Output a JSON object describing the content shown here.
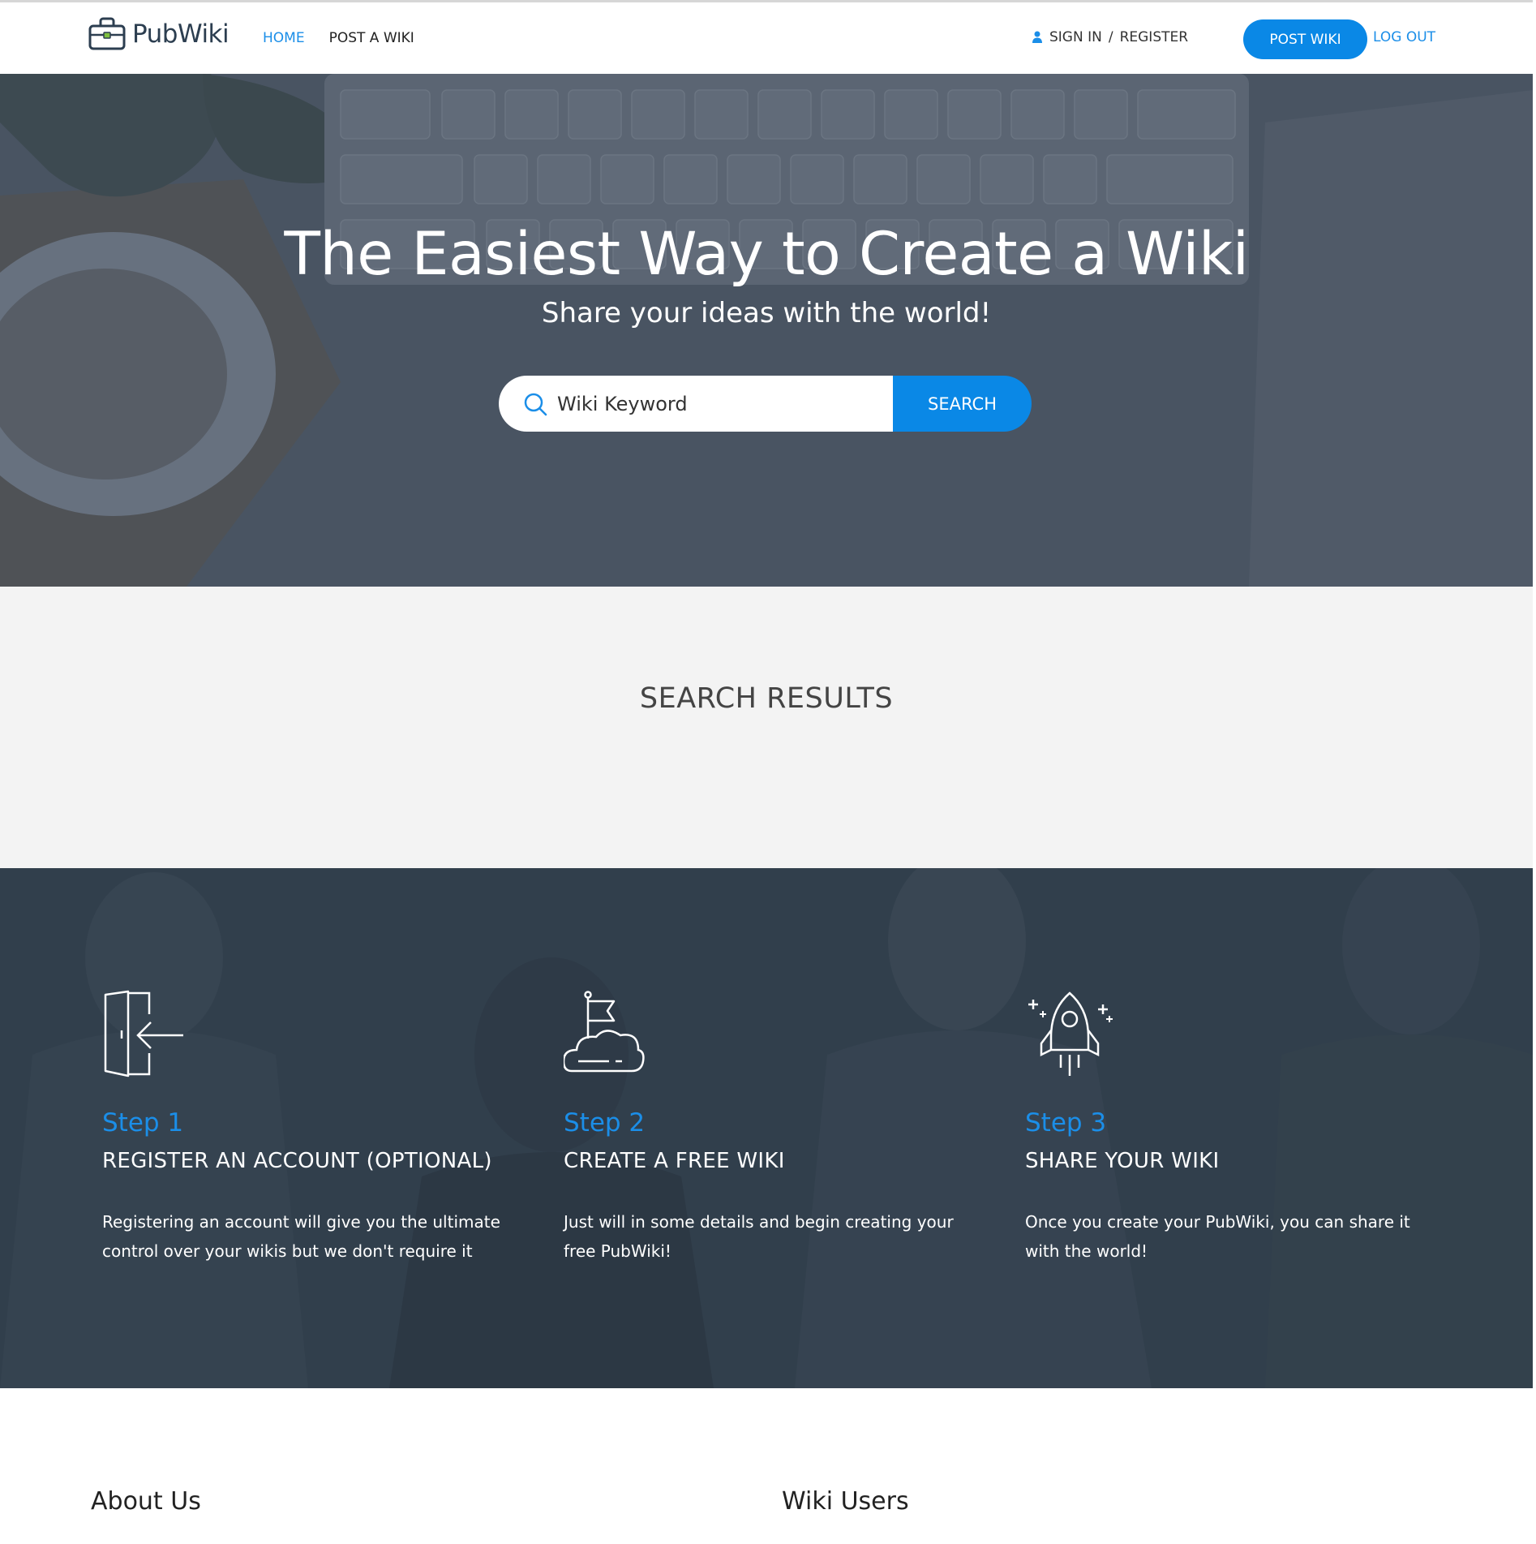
{
  "header": {
    "logo_text": "PubWiki",
    "nav": {
      "home": "HOME",
      "post": "POST A WIKI"
    },
    "signin": "SIGN IN",
    "sep": "/",
    "register": "REGISTER",
    "post_button": "POST WIKI",
    "logout": "LOG OUT"
  },
  "hero": {
    "title": "The Easiest Way to Create a Wiki",
    "subtitle": "Share your ideas with the world!",
    "search_placeholder": "Wiki Keyword",
    "search_button": "SEARCH"
  },
  "results": {
    "title": "SEARCH RESULTS"
  },
  "steps": [
    {
      "icon": "sign-in-door-icon",
      "num": "Step 1",
      "title": "REGISTER AN ACCOUNT (OPTIONAL)",
      "desc": "Registering an account will give you the ultimate control over your wikis but we don't require it"
    },
    {
      "icon": "flag-cloud-icon",
      "num": "Step 2",
      "title": "CREATE A FREE WIKI",
      "desc": "Just will in some details and begin creating your free PubWiki!"
    },
    {
      "icon": "rocket-icon",
      "num": "Step 3",
      "title": "SHARE YOUR WIKI",
      "desc": "Once you create your PubWiki, you can share it with the world!"
    }
  ],
  "footer": {
    "about": "About Us",
    "users": "Wiki Users"
  },
  "colors": {
    "accent": "#0a88e6",
    "hero_overlay": "#4d5866",
    "steps_bg": "#33404e",
    "results_bg": "#f3f3f3"
  }
}
